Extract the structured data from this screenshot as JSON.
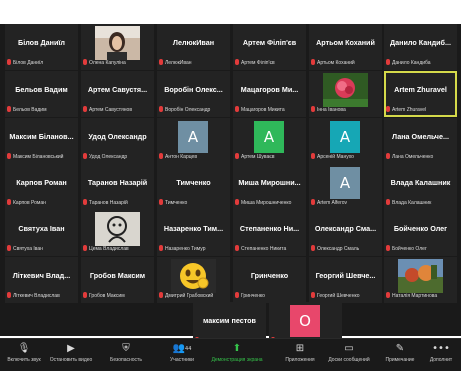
{
  "tiles": [
    {
      "big": "Білов Даниїл",
      "cap": "Білов Даниїл",
      "kind": "name"
    },
    {
      "big": "",
      "cap": "Олена Капуліна",
      "kind": "photo-woman"
    },
    {
      "big": "ЛелюкИван",
      "cap": "ЛелюкИван",
      "kind": "name"
    },
    {
      "big": "Артем Філіп'єв",
      "cap": "Артем Філіп'єв",
      "kind": "name"
    },
    {
      "big": "Артьом Коханий",
      "cap": "Артьом Коханий",
      "kind": "name"
    },
    {
      "big": "Данило Кандиб...",
      "cap": "Данило Кандиба",
      "kind": "name"
    },
    {
      "big": "Бельов Вадим",
      "cap": "Бельов Вадим",
      "kind": "name"
    },
    {
      "big": "Артем Савустя...",
      "cap": "Артем Савустянов",
      "kind": "name"
    },
    {
      "big": "Воробін Олекс...",
      "cap": "Воробін Олександр",
      "kind": "name"
    },
    {
      "big": "Мацагоров Ми...",
      "cap": "Мацагоров Микита",
      "kind": "name"
    },
    {
      "big": "",
      "cap": "Інна Іванова",
      "kind": "photo-flower"
    },
    {
      "big": "Artem Zhuravel",
      "cap": "Artem Zhuravel",
      "kind": "name",
      "active": true
    },
    {
      "big": "Максим Біланов...",
      "cap": "Максим Білановський",
      "kind": "name"
    },
    {
      "big": "Удод Олександр",
      "cap": "Удод Олександр",
      "kind": "name"
    },
    {
      "big": "A",
      "cap": "Антон Карцев",
      "kind": "letter",
      "color": "#6f8fa3"
    },
    {
      "big": "A",
      "cap": "Артем Шуваєв",
      "kind": "letter",
      "color": "#2fb85a"
    },
    {
      "big": "A",
      "cap": "Арсеній Манухо",
      "kind": "letter",
      "color": "#16a7b5"
    },
    {
      "big": "Лана Омельче...",
      "cap": "Лана Омельченко",
      "kind": "name"
    },
    {
      "big": "Карпов Роман",
      "cap": "Карпов Роман",
      "kind": "name"
    },
    {
      "big": "Таранов Назарій",
      "cap": "Таранов Назарій",
      "kind": "name"
    },
    {
      "big": "Тимченко",
      "cap": "Тимченко",
      "kind": "name"
    },
    {
      "big": "Миша Мирошни...",
      "cap": "Миша Мирошниченко",
      "kind": "name"
    },
    {
      "big": "A",
      "cap": "Artem Alferov",
      "kind": "letter",
      "color": "#6f8fa3"
    },
    {
      "big": "Влада Калашник",
      "cap": "Влада Калашник",
      "kind": "name"
    },
    {
      "big": "Святуха Іван",
      "cap": "Святуха Іван",
      "kind": "name"
    },
    {
      "big": "",
      "cap": "Цема Владислав",
      "kind": "photo-drawing"
    },
    {
      "big": "Назаренко Тим...",
      "cap": "Назаренко Тимур",
      "kind": "name"
    },
    {
      "big": "Степаненко Ни...",
      "cap": "Степаненко Никита",
      "kind": "name"
    },
    {
      "big": "Олександр Сма...",
      "cap": "Олександр Смаль",
      "kind": "name"
    },
    {
      "big": "Бойченко Олег",
      "cap": "Бойченко Олег",
      "kind": "name"
    },
    {
      "big": "Літкевич Влад...",
      "cap": "Літкевич Владислав",
      "kind": "name"
    },
    {
      "big": "Гробов Максим",
      "cap": "Гробов Максим",
      "kind": "name"
    },
    {
      "big": "",
      "cap": "Дмитрий Грабовский",
      "kind": "photo-emoji"
    },
    {
      "big": "Гринченко",
      "cap": "Гринченко",
      "kind": "name"
    },
    {
      "big": "Георгий Шевче...",
      "cap": "Георгий Шевченко",
      "kind": "name"
    },
    {
      "big": "",
      "cap": "Наталія Мартинова",
      "kind": "photo-landscape"
    },
    {
      "big": "максим пестов",
      "cap": "максим пестов",
      "kind": "name"
    },
    {
      "big": "O",
      "cap": "Ольга Котова",
      "kind": "letter",
      "color": "#e8476b"
    }
  ],
  "toolbar": {
    "mic": {
      "label": "Включить звук",
      "icon": "microphone-icon"
    },
    "video": {
      "label": "Остановить видео",
      "icon": "video-camera-icon"
    },
    "security": {
      "label": "Безопасность",
      "icon": "shield-icon"
    },
    "participants": {
      "label": "Участники",
      "count": "44",
      "icon": "participants-icon"
    },
    "share": {
      "label": "Демонстрация экрана",
      "icon": "share-screen-icon",
      "color": "#35c24a"
    },
    "apps": {
      "label": "Приложения",
      "icon": "apps-icon"
    },
    "docs": {
      "label": "Доски сообщений",
      "icon": "whiteboard-icon"
    },
    "notes": {
      "label": "Примечание",
      "icon": "notes-icon"
    },
    "more": {
      "label": "Дополнит",
      "icon": "more-icon"
    }
  }
}
